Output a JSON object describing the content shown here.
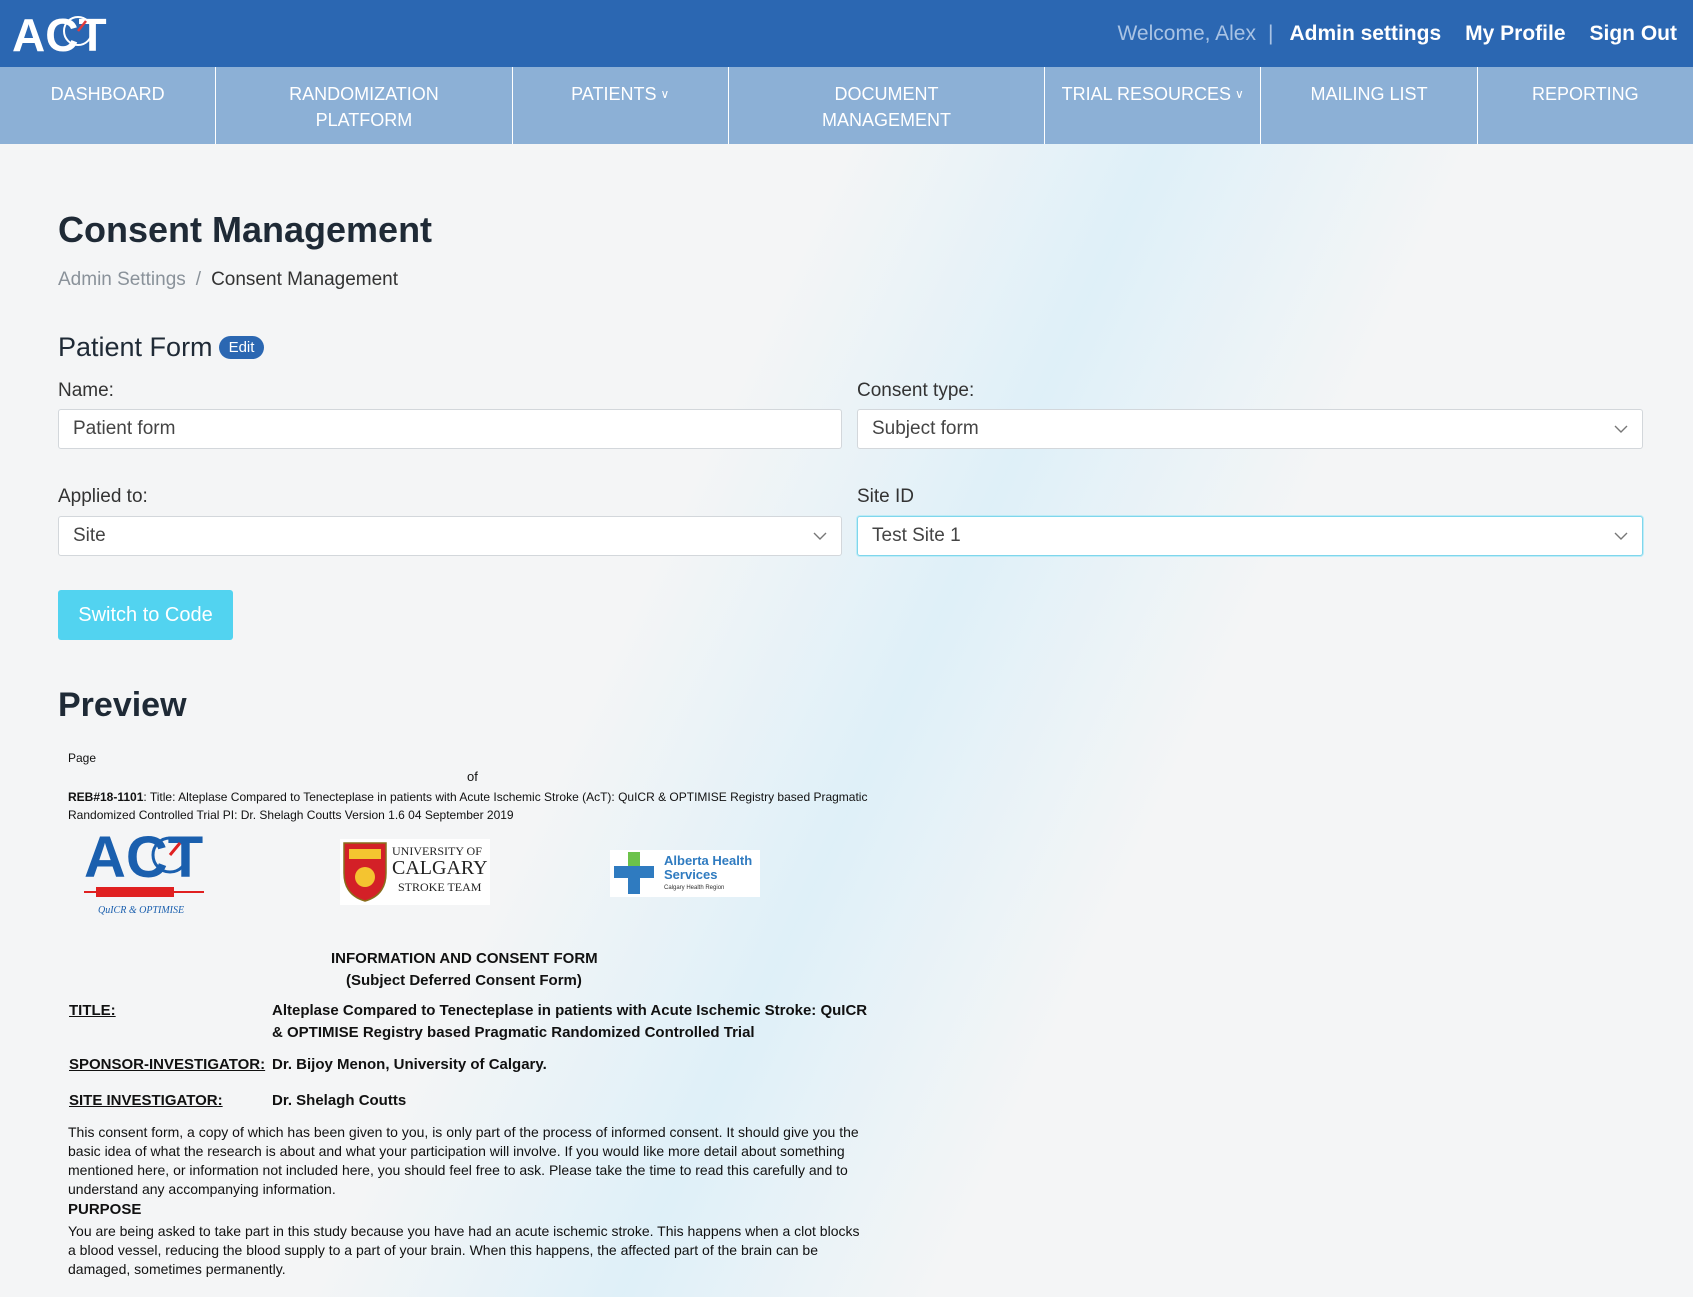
{
  "header": {
    "logo_text": "ACT",
    "welcome": "Welcome, Alex",
    "separator": "|",
    "links": [
      "Admin settings",
      "My Profile",
      "Sign Out"
    ]
  },
  "nav": {
    "items": [
      {
        "label": "DASHBOARD"
      },
      {
        "label": "RANDOMIZATION PLATFORM"
      },
      {
        "label": "PATIENTS"
      },
      {
        "label": "DOCUMENT MANAGEMENT"
      },
      {
        "label": "TRIAL RESOURCES"
      },
      {
        "label": "MAILING LIST"
      },
      {
        "label": "REPORTING"
      }
    ]
  },
  "page": {
    "title": "Consent Management",
    "breadcrumb": {
      "parent": "Admin Settings",
      "separator": "/",
      "current": "Consent Management"
    }
  },
  "form": {
    "section_title": "Patient Form",
    "edit_label": "Edit",
    "name_label": "Name:",
    "name_value": "Patient form",
    "consent_type_label": "Consent type:",
    "consent_type_value": "Subject form",
    "applied_to_label": "Applied to:",
    "applied_to_value": "Site",
    "site_id_label": "Site ID",
    "site_id_value": "Test Site 1",
    "switch_button": "Switch to Code"
  },
  "preview": {
    "title": "Preview",
    "page_label": "Page",
    "of_label": "of",
    "reb_bold": "REB#18-1101",
    "reb_text": ": Title: Alteplase Compared to Tenecteplase in patients with Acute Ischemic Stroke (AcT): QuICR & OPTIMISE Registry based Pragmatic Randomized Controlled Trial   PI: Dr. Shelagh Coutts Version 1.6 04 September 2019",
    "act_logo_text": "ACT",
    "act_logo_sub": "QuICR & OPTIMISE",
    "uc_logo_line1": "UNIVERSITY OF",
    "uc_logo_line2": "CALGARY",
    "uc_logo_line3": "STROKE TEAM",
    "ahs_line1": "Alberta Health",
    "ahs_line2": "Services",
    "ahs_line3": "Calgary Health Region",
    "heading1": "INFORMATION AND CONSENT FORM",
    "heading2": "(Subject Deferred Consent Form)",
    "title_key": "TITLE:",
    "title_value": "Alteplase Compared to Tenecteplase in patients with Acute Ischemic Stroke: QuICR & OPTIMISE Registry based Pragmatic Randomized Controlled Trial",
    "sponsor_key": "SPONSOR-INVESTIGATOR:",
    "sponsor_value": "Dr. Bijoy Menon, University of Calgary.",
    "site_inv_key": "SITE INVESTIGATOR:",
    "site_inv_value": "Dr. Shelagh Coutts",
    "intro_para": "This consent form, a copy of which has been given to you, is only part of the process of informed consent. It should give you the basic idea of what the research is about and what your participation will involve. If you would like more detail about something mentioned here, or information not included here, you should feel free to ask. Please take the time to read this carefully and to understand any accompanying information.",
    "purpose_heading": "PURPOSE",
    "purpose_para": "You are being asked to take part in this study because you have had an acute ischemic stroke. This happens when a clot blocks a blood vessel, reducing the blood supply to a part of your brain. When this happens, the affected part of the brain can be damaged, sometimes permanently."
  },
  "colors": {
    "header_bg": "#2b67b2",
    "nav_bg": "#8cb0d6",
    "button_bg": "#52d3f0",
    "badge_bg": "#2b67b2"
  }
}
